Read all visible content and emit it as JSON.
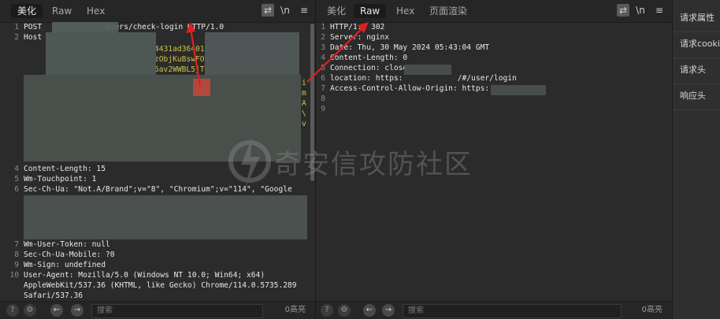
{
  "left": {
    "tabs": [
      "美化",
      "Raw",
      "Hex"
    ],
    "active_tab": 0,
    "toolbar": {
      "newline": "\\n"
    },
    "lines": [
      {
        "n": "1",
        "text": "POST              users/check-login HTTP/1.0"
      },
      {
        "n": "2",
        "text": "Host"
      },
      {
        "n": "4",
        "text": "Content-Length: 15"
      },
      {
        "n": "5",
        "text": "Wm-Touchpoint: 1"
      },
      {
        "n": "6",
        "text": "Sec-Ch-Ua: \"Not.A/Brand\";v=\"8\", \"Chromium\";v=\"114\", \"Google"
      },
      {
        "n": "7",
        "text": "Wm-User-Token: null"
      },
      {
        "n": "8",
        "text": "Sec-Ch-Ua-Mobile: ?0"
      },
      {
        "n": "9",
        "text": "Wm-Sign: undefined"
      },
      {
        "n": "10",
        "text": "User-Agent: Mozilla/5.0 (Windows NT 10.0; Win64; x64)"
      },
      {
        "n": "",
        "text": "AppleWebKit/537.36 (KHTML, like Gecko) Chrome/114.0.5735.289"
      },
      {
        "n": "",
        "text": "Safari/537.36"
      }
    ],
    "cookie_fragments": [
      "4431ad364013",
      "zObjKuBswFO8",
      "5av2WWBL5jT="
    ],
    "status": {
      "search_placeholder": "搜索",
      "count": "0高亮"
    }
  },
  "right": {
    "tabs": [
      "美化",
      "Raw",
      "Hex",
      "页面渲染"
    ],
    "active_tab": 1,
    "toolbar": {
      "newline": "\\n"
    },
    "lines": [
      {
        "n": "1",
        "text": "HTTP/1.1 302"
      },
      {
        "n": "2",
        "text": "Server: nginx"
      },
      {
        "n": "3",
        "text": "Date: Thu, 30 May 2024 05:43:04 GMT"
      },
      {
        "n": "4",
        "text": "Content-Length: 0"
      },
      {
        "n": "5",
        "text": "Connection: close"
      },
      {
        "n": "6",
        "text": "location: https:            /#/user/login"
      },
      {
        "n": "7",
        "text": "Access-Control-Allow-Origin: https:"
      },
      {
        "n": "8",
        "text": ""
      },
      {
        "n": "9",
        "text": ""
      }
    ],
    "status": {
      "search_placeholder": "搜索",
      "count": "0高亮"
    }
  },
  "side": {
    "items": [
      "请求属性",
      "请求cookie",
      "请求头",
      "响应头"
    ]
  },
  "watermark": {
    "text": "奇安信攻防社区"
  },
  "colors": {
    "accent_arrow": "#e02020",
    "header_yellow": "#c9c44a"
  }
}
